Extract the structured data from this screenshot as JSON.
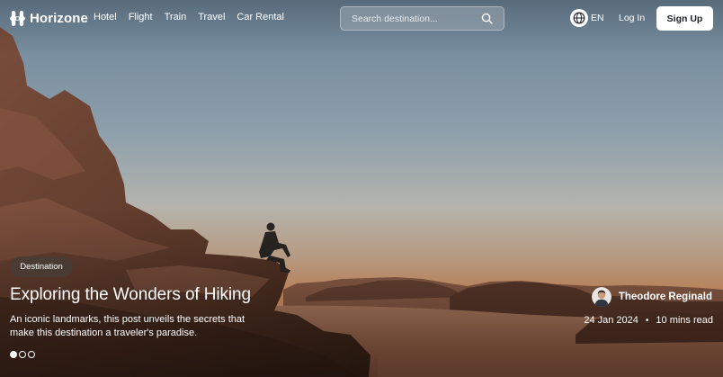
{
  "brand": {
    "name": "Horizone",
    "icon": "logo-icon"
  },
  "nav": {
    "links": [
      "Hotel",
      "Flight",
      "Train",
      "Travel",
      "Car Rental"
    ]
  },
  "search": {
    "placeholder": "Search destination...",
    "value": "",
    "icon": "search-icon"
  },
  "header_actions": {
    "language_icon": "globe-icon",
    "language": "EN",
    "login_label": "Log In",
    "signup_label": "Sign Up"
  },
  "hero": {
    "category": "Destination",
    "title": "Exploring the Wonders of Hiking",
    "description": "An iconic landmarks, this post unveils the secrets that make this destination a traveler's paradise.",
    "author": {
      "name": "Theodore Reginald"
    },
    "date": "24 Jan 2024",
    "separator": "•",
    "read_time": "10 mins read",
    "carousel": {
      "total": 3,
      "active": 1
    }
  },
  "colors": {
    "sky_top": "#6a8296",
    "horizon": "#e4a77b",
    "rock": "#6b4334",
    "sand": "#b87c5c",
    "signup_bg": "#ffffff"
  }
}
